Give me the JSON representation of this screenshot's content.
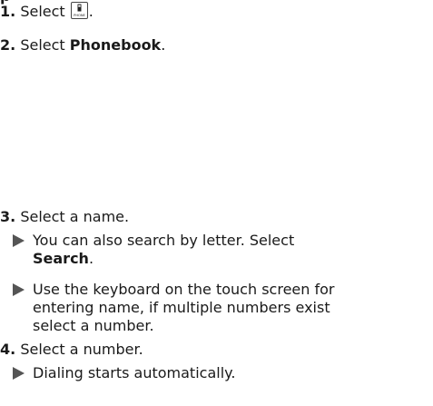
{
  "steps": [
    {
      "num": "1.",
      "prefix": "Select ",
      "icon": "phone-icon",
      "icon_label": "PHONE",
      "suffix": "."
    },
    {
      "num": "2.",
      "prefix": "Select ",
      "bold": "Phonebook",
      "suffix": "."
    },
    {
      "num": "3.",
      "text": "Select a name."
    },
    {
      "num": "4.",
      "text": "Select a number."
    }
  ],
  "notes": {
    "search": {
      "line1": "You can also search by letter. Select",
      "bold": "Search",
      "suffix": "."
    },
    "keyboard": {
      "line1": "Use the keyboard on the touch screen for",
      "line2": "entering name, if multiple numbers exist",
      "line3": "select a number."
    },
    "dialing": {
      "line1": "Dialing starts automatically."
    }
  },
  "colors": {
    "text": "#1a1a1a",
    "arrow": "#555555"
  }
}
